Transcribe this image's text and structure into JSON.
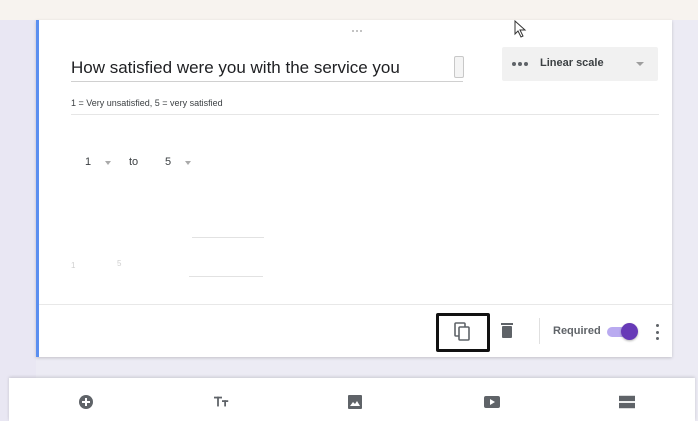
{
  "question": {
    "title": "How satisfied were you with the service you",
    "description": "1 = Very unsatisfied, 5 = very satisfied"
  },
  "question_type": {
    "icon": "linear-scale-icon",
    "label": "Linear scale"
  },
  "scale": {
    "min": "1",
    "to_label": "to",
    "max": "5"
  },
  "footer": {
    "duplicate_icon": "content-copy-icon",
    "delete_icon": "trash-icon",
    "required_label": "Required",
    "required_on": true,
    "more_icon": "more-vert-icon"
  },
  "bottom_toolbar": [
    "add-question-icon",
    "add-title-icon",
    "add-image-icon",
    "add-video-icon",
    "add-section-icon"
  ],
  "colors": {
    "accent": "#673ab7",
    "accent_track": "#b9aaf0",
    "focus_border": "#5b8ff0",
    "highlight_box": "#111111"
  }
}
